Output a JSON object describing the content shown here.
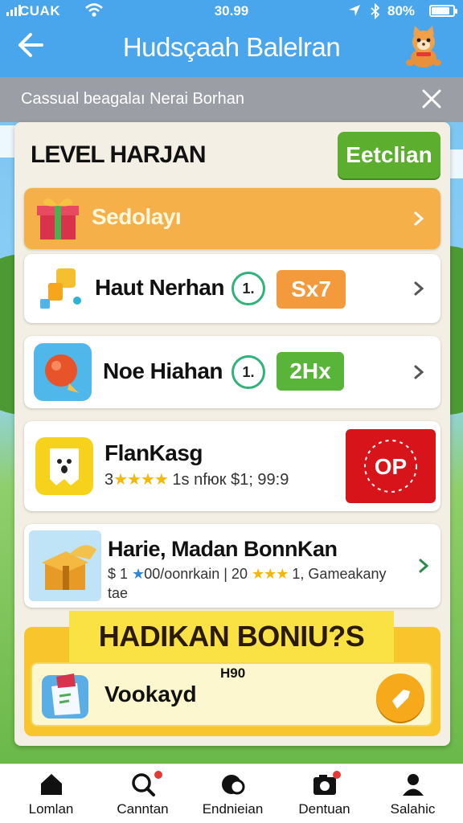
{
  "status_bar": {
    "carrier": "CUAK",
    "time": "30.99",
    "battery": "80%"
  },
  "header": {
    "title": "Hudsçaah Balelran"
  },
  "banner": {
    "text": "Cassual beagalaı Nerai Borhan"
  },
  "panel": {
    "title": "LEVEL HARJAN",
    "action_label": "Eetclian"
  },
  "items": [
    {
      "name": "Sedolayı"
    },
    {
      "name": "Haut Nerhan",
      "badge": "1.",
      "pill": "Sx7",
      "pill_color": "#f39a3c"
    },
    {
      "name": "Noe Hiahan",
      "badge": "1.",
      "pill": "2Hx",
      "pill_color": "#58b53a"
    },
    {
      "name": "FlanKasg",
      "rating_prefix": "3",
      "stars": "★★★★",
      "meta": "1s nfюк $1; 99:9",
      "seal_text": "OP"
    },
    {
      "name": "Harie, Madan BonnKan",
      "sub_line1_a": "$ 1",
      "sub_line1_star": "★",
      "sub_line1_b": "00/oonrkain | 20",
      "sub_stars": "★★★",
      "sub_line1_c": "1, Gameakany",
      "sub_line2": "tae"
    }
  ],
  "bonus": {
    "title": "HADIKAN BONIU?S",
    "tag": "H90",
    "item_name": "Vookayd"
  },
  "nav": [
    {
      "label": "Lomlan",
      "icon": "home-icon"
    },
    {
      "label": "Canntan",
      "icon": "search-icon"
    },
    {
      "label": "Endnieian",
      "icon": "globe-icon"
    },
    {
      "label": "Dentuan",
      "icon": "camera-icon"
    },
    {
      "label": "Salahic",
      "icon": "profile-icon"
    }
  ],
  "colors": {
    "header_blue": "#4aa6ec",
    "action_green": "#5cae2e",
    "orange_row": "#f6b04a",
    "bonus_yellow": "#f8c62c",
    "seal_red": "#d7141a"
  }
}
